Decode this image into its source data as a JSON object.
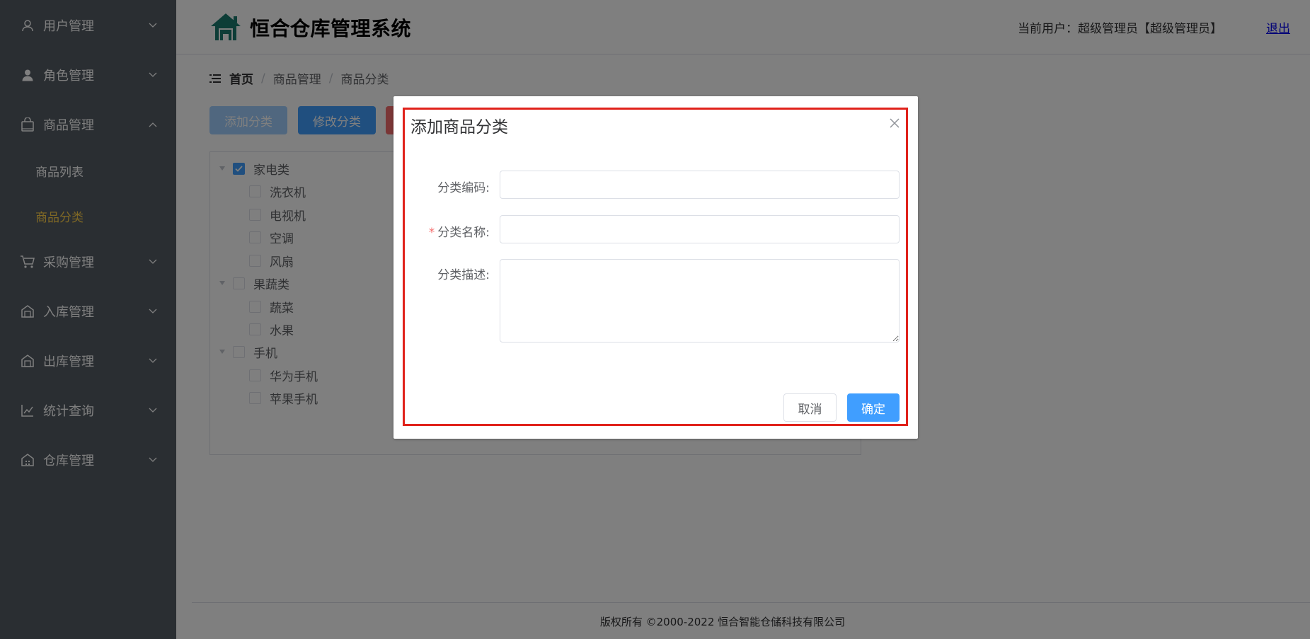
{
  "sidebar": {
    "items": [
      {
        "label": "用户管理",
        "icon": "user-outline-icon",
        "expanded": false
      },
      {
        "label": "角色管理",
        "icon": "user-solid-icon",
        "expanded": false
      },
      {
        "label": "商品管理",
        "icon": "shopping-bag-icon",
        "expanded": true
      },
      {
        "label": "采购管理",
        "icon": "shopping-cart-icon",
        "expanded": false
      },
      {
        "label": "入库管理",
        "icon": "warehouse-in-icon",
        "expanded": false
      },
      {
        "label": "出库管理",
        "icon": "warehouse-out-icon",
        "expanded": false
      },
      {
        "label": "统计查询",
        "icon": "chart-icon",
        "expanded": false
      },
      {
        "label": "仓库管理",
        "icon": "building-icon",
        "expanded": false
      }
    ],
    "sub_items": [
      {
        "label": "商品列表",
        "active": false
      },
      {
        "label": "商品分类",
        "active": true
      }
    ]
  },
  "header": {
    "title": "恒合仓库管理系统",
    "user_text": "当前用户：超级管理员【超级管理员】",
    "logout_label": "退出"
  },
  "breadcrumb": {
    "home": "首页",
    "level1": "商品管理",
    "level2": "商品分类",
    "separator": "/"
  },
  "toolbar": {
    "add_label": "添加分类",
    "edit_label": "修改分类",
    "delete_label": ""
  },
  "tree": {
    "groups": [
      {
        "label": "家电类",
        "checked": true,
        "children": [
          "洗衣机",
          "电视机",
          "空调",
          "风扇"
        ]
      },
      {
        "label": "果蔬类",
        "checked": false,
        "children": [
          "蔬菜",
          "水果"
        ]
      },
      {
        "label": "手机",
        "checked": false,
        "children": [
          "华为手机",
          "苹果手机"
        ]
      }
    ]
  },
  "dialog": {
    "title": "添加商品分类",
    "fields": {
      "code_label": "分类编码:",
      "name_label": "分类名称:",
      "desc_label": "分类描述:",
      "required_mark": "*",
      "code_value": "",
      "name_value": "",
      "desc_value": ""
    },
    "cancel_label": "取消",
    "ok_label": "确定"
  },
  "footer": {
    "text": "版权所有 ©2000-2022  恒合智能仓储科技有限公司"
  },
  "colors": {
    "sidebar_bg": "#545c64",
    "active_menu": "#ffd04b",
    "primary": "#409eff",
    "danger": "#f56c6c",
    "highlight_frame": "#e0221b"
  }
}
